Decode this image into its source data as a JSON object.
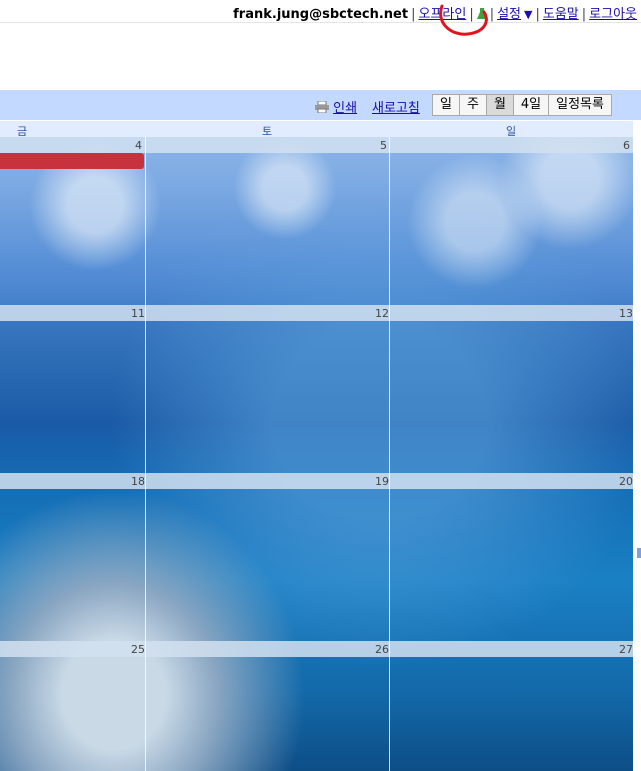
{
  "header": {
    "email": "frank.jung@sbctech.net",
    "links": {
      "offline": "오프라인",
      "settings": "설정",
      "help": "도움말",
      "logout": "로그아웃"
    },
    "separator": "|"
  },
  "toolbar": {
    "print": "인쇄",
    "refresh": "새로고침",
    "views": [
      "일",
      "주",
      "월",
      "4일",
      "일정목록"
    ],
    "active_view": "월"
  },
  "day_headers": [
    "금",
    "토",
    "일"
  ],
  "weeks": [
    {
      "dates": [
        "4",
        "5",
        "6"
      ]
    },
    {
      "dates": [
        "11",
        "12",
        "13"
      ]
    },
    {
      "dates": [
        "18",
        "19",
        "20"
      ]
    },
    {
      "dates": [
        "25",
        "26",
        "27"
      ]
    }
  ],
  "colors": {
    "accent": "#c3d9ff",
    "link": "#1a0dab",
    "event": "#c7323d",
    "annotation": "#e0141e"
  }
}
